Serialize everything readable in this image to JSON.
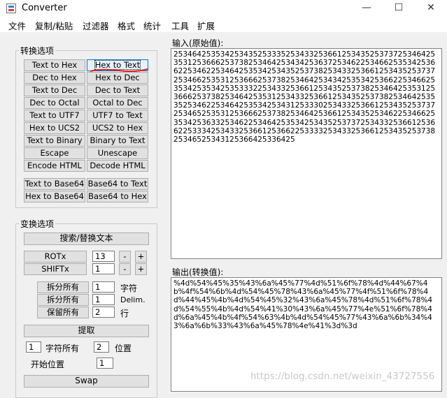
{
  "window": {
    "title": "Converter",
    "min": "—",
    "max": "☐",
    "close": "✕"
  },
  "menu": [
    "文件",
    "复制/粘贴",
    "过滤器",
    "格式",
    "统计",
    "工具",
    "扩展"
  ],
  "convert_group": {
    "title": "转换选项",
    "buttons": [
      [
        "Text to Hex",
        "Hex to Text"
      ],
      [
        "Dec to Hex",
        "Hex to Dec"
      ],
      [
        "Text to Dec",
        "Dec to Text"
      ],
      [
        "Dec to Octal",
        "Octal to Dec"
      ],
      [
        "Text to UTF7",
        "UTF7 to Text"
      ],
      [
        "Hex to UCS2",
        "UCS2 to Hex"
      ],
      [
        "Text to Binary",
        "Binary to Text"
      ],
      [
        "Escape",
        "Unescape"
      ],
      [
        "Encode HTML",
        "Decode HTML"
      ],
      [
        "Text to Base64",
        "Base64 to Text"
      ],
      [
        "Hex to Base64",
        "Base64 to Hex"
      ]
    ]
  },
  "transform_group": {
    "title": "变换选项",
    "search_replace": "搜索/替换文本",
    "rotx_label": "ROTx",
    "rotx_value": "13",
    "shiftx_label": "SHIFTx",
    "shiftx_value": "1",
    "minus": "-",
    "plus": "+",
    "split_all_1": "拆分所有",
    "split_all_1_value": "1",
    "split_all_1_unit": "字符",
    "split_all_2": "拆分所有",
    "split_all_2_value": "1",
    "split_all_2_unit": "Delim.",
    "keep_all": "保留所有",
    "keep_all_value": "2",
    "keep_all_unit": "行",
    "extract": "提取",
    "extract_count": "1",
    "extract_chars_label": "字符所有",
    "extract_pos_value": "2",
    "extract_pos_label": "位置",
    "start_pos_label": "开始位置",
    "start_pos_value": "1",
    "swap": "Swap"
  },
  "input": {
    "label": "输入(原始值):",
    "text": "2534642535342534352533352534332536612534352537372534642535312536662537382534642534342536372534622534662535342536622534622534642535342534352537382534332536612534352537372534662535312536662537382534642534342535342536622534662535342535342535333225343325366125343525373825346425353125366625373825346425353125343325366125343525373825346425353525346225346425353425343125333025343325366125343525373725346525353125366625373825346425366125343525346225346625353425363325346225346425353425343525373725343325366125366225333425343325366125366225333325343325366125343525373825346525343125366425336425"
  },
  "output": {
    "label": "输出(转换值):",
    "text": "%4d%54%45%35%43%6a%45%77%4d%51%6f%78%4d%44%67%4b%4f%54%6b%4d%54%45%78%43%6a%45%77%4f%51%6f%78%4d%44%45%4b%4d%54%45%32%43%6a%45%78%4d%51%6f%78%4d%54%55%4b%4d%54%41%30%43%6a%45%77%4e%51%6f%78%4d%6a%45%4b%4f%54%63%4b%4d%54%45%77%43%6a%6b%34%43%6a%6b%33%43%6a%45%78%4e%41%3d%3d"
  },
  "watermark": "https://blog.csdn.net/weixin_43727556"
}
